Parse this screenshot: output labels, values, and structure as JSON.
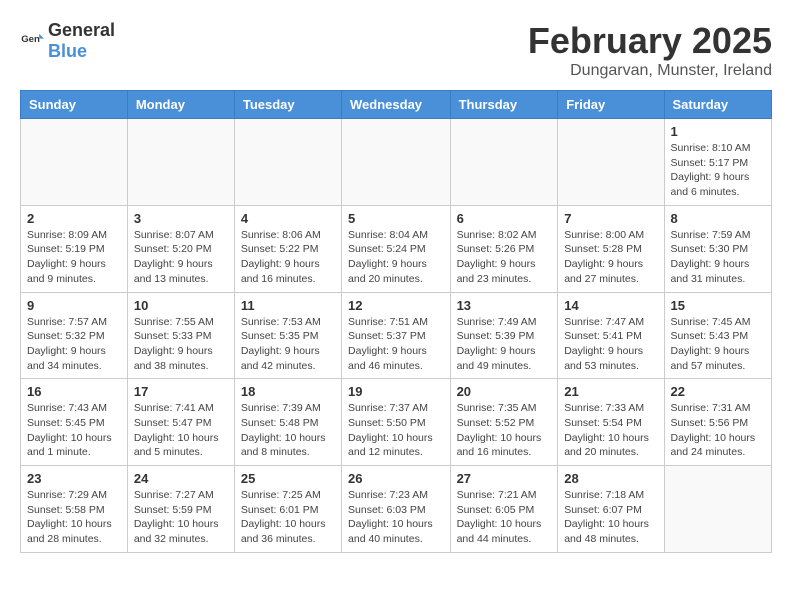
{
  "header": {
    "logo": {
      "general": "General",
      "blue": "Blue"
    },
    "title": "February 2025",
    "location": "Dungarvan, Munster, Ireland"
  },
  "calendar": {
    "days_of_week": [
      "Sunday",
      "Monday",
      "Tuesday",
      "Wednesday",
      "Thursday",
      "Friday",
      "Saturday"
    ],
    "weeks": [
      [
        {
          "day": "",
          "info": ""
        },
        {
          "day": "",
          "info": ""
        },
        {
          "day": "",
          "info": ""
        },
        {
          "day": "",
          "info": ""
        },
        {
          "day": "",
          "info": ""
        },
        {
          "day": "",
          "info": ""
        },
        {
          "day": "1",
          "info": "Sunrise: 8:10 AM\nSunset: 5:17 PM\nDaylight: 9 hours and 6 minutes."
        }
      ],
      [
        {
          "day": "2",
          "info": "Sunrise: 8:09 AM\nSunset: 5:19 PM\nDaylight: 9 hours and 9 minutes."
        },
        {
          "day": "3",
          "info": "Sunrise: 8:07 AM\nSunset: 5:20 PM\nDaylight: 9 hours and 13 minutes."
        },
        {
          "day": "4",
          "info": "Sunrise: 8:06 AM\nSunset: 5:22 PM\nDaylight: 9 hours and 16 minutes."
        },
        {
          "day": "5",
          "info": "Sunrise: 8:04 AM\nSunset: 5:24 PM\nDaylight: 9 hours and 20 minutes."
        },
        {
          "day": "6",
          "info": "Sunrise: 8:02 AM\nSunset: 5:26 PM\nDaylight: 9 hours and 23 minutes."
        },
        {
          "day": "7",
          "info": "Sunrise: 8:00 AM\nSunset: 5:28 PM\nDaylight: 9 hours and 27 minutes."
        },
        {
          "day": "8",
          "info": "Sunrise: 7:59 AM\nSunset: 5:30 PM\nDaylight: 9 hours and 31 minutes."
        }
      ],
      [
        {
          "day": "9",
          "info": "Sunrise: 7:57 AM\nSunset: 5:32 PM\nDaylight: 9 hours and 34 minutes."
        },
        {
          "day": "10",
          "info": "Sunrise: 7:55 AM\nSunset: 5:33 PM\nDaylight: 9 hours and 38 minutes."
        },
        {
          "day": "11",
          "info": "Sunrise: 7:53 AM\nSunset: 5:35 PM\nDaylight: 9 hours and 42 minutes."
        },
        {
          "day": "12",
          "info": "Sunrise: 7:51 AM\nSunset: 5:37 PM\nDaylight: 9 hours and 46 minutes."
        },
        {
          "day": "13",
          "info": "Sunrise: 7:49 AM\nSunset: 5:39 PM\nDaylight: 9 hours and 49 minutes."
        },
        {
          "day": "14",
          "info": "Sunrise: 7:47 AM\nSunset: 5:41 PM\nDaylight: 9 hours and 53 minutes."
        },
        {
          "day": "15",
          "info": "Sunrise: 7:45 AM\nSunset: 5:43 PM\nDaylight: 9 hours and 57 minutes."
        }
      ],
      [
        {
          "day": "16",
          "info": "Sunrise: 7:43 AM\nSunset: 5:45 PM\nDaylight: 10 hours and 1 minute."
        },
        {
          "day": "17",
          "info": "Sunrise: 7:41 AM\nSunset: 5:47 PM\nDaylight: 10 hours and 5 minutes."
        },
        {
          "day": "18",
          "info": "Sunrise: 7:39 AM\nSunset: 5:48 PM\nDaylight: 10 hours and 8 minutes."
        },
        {
          "day": "19",
          "info": "Sunrise: 7:37 AM\nSunset: 5:50 PM\nDaylight: 10 hours and 12 minutes."
        },
        {
          "day": "20",
          "info": "Sunrise: 7:35 AM\nSunset: 5:52 PM\nDaylight: 10 hours and 16 minutes."
        },
        {
          "day": "21",
          "info": "Sunrise: 7:33 AM\nSunset: 5:54 PM\nDaylight: 10 hours and 20 minutes."
        },
        {
          "day": "22",
          "info": "Sunrise: 7:31 AM\nSunset: 5:56 PM\nDaylight: 10 hours and 24 minutes."
        }
      ],
      [
        {
          "day": "23",
          "info": "Sunrise: 7:29 AM\nSunset: 5:58 PM\nDaylight: 10 hours and 28 minutes."
        },
        {
          "day": "24",
          "info": "Sunrise: 7:27 AM\nSunset: 5:59 PM\nDaylight: 10 hours and 32 minutes."
        },
        {
          "day": "25",
          "info": "Sunrise: 7:25 AM\nSunset: 6:01 PM\nDaylight: 10 hours and 36 minutes."
        },
        {
          "day": "26",
          "info": "Sunrise: 7:23 AM\nSunset: 6:03 PM\nDaylight: 10 hours and 40 minutes."
        },
        {
          "day": "27",
          "info": "Sunrise: 7:21 AM\nSunset: 6:05 PM\nDaylight: 10 hours and 44 minutes."
        },
        {
          "day": "28",
          "info": "Sunrise: 7:18 AM\nSunset: 6:07 PM\nDaylight: 10 hours and 48 minutes."
        },
        {
          "day": "",
          "info": ""
        }
      ]
    ]
  }
}
